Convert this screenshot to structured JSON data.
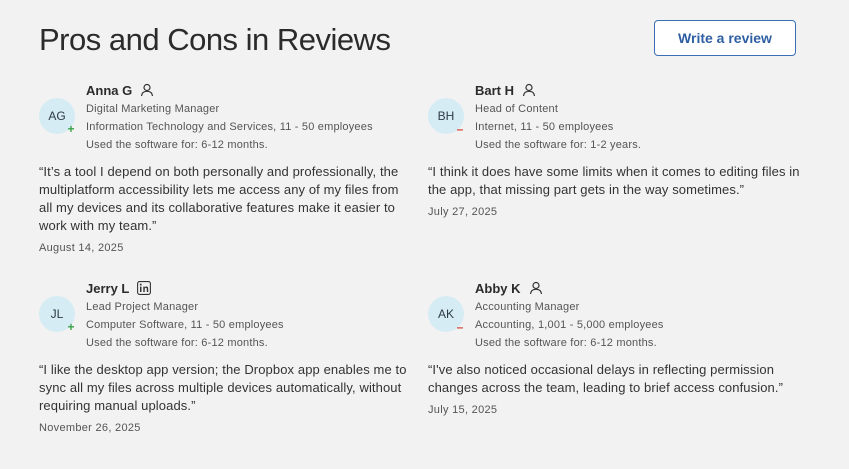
{
  "header": {
    "title": "Pros and Cons in Reviews",
    "write_review_label": "Write a review"
  },
  "reviews": [
    {
      "initials": "AG",
      "name": "Anna G",
      "badge": "user-icon",
      "sentiment": "+",
      "role": "Digital Marketing Manager",
      "company": "Information Technology and Services, 11 - 50 employees",
      "usage": "Used the software for: 6-12 months.",
      "quote": "“It’s a tool I depend on both personally and professionally, the multiplatform accessibility lets me access any of my files from all my devices and its collaborative features make it easier to work with my team.”",
      "date": "August 14, 2025"
    },
    {
      "initials": "BH",
      "name": "Bart H",
      "badge": "user-icon",
      "sentiment": "–",
      "role": "Head of Content",
      "company": "Internet, 11 - 50 employees",
      "usage": "Used the software for: 1-2 years.",
      "quote": "“I think it does have some limits when it comes to editing files in the app, that missing part gets in the way sometimes.”",
      "date": "July 27, 2025"
    },
    {
      "initials": "JL",
      "name": "Jerry L",
      "badge": "linkedin-icon",
      "sentiment": "+",
      "role": "Lead Project Manager",
      "company": "Computer Software, 11 - 50 employees",
      "usage": "Used the software for: 6-12 months.",
      "quote": "“I like the desktop app version; the Dropbox app enables me to sync all my files across multiple devices automatically, without requiring manual uploads.”",
      "date": "November 26, 2025"
    },
    {
      "initials": "AK",
      "name": "Abby K",
      "badge": "user-icon",
      "sentiment": "–",
      "role": "Accounting Manager",
      "company": "Accounting, 1,001 - 5,000 employees",
      "usage": "Used the software for: 6-12 months.",
      "quote": "“I've also noticed occasional delays in reflecting permission changes across the team, leading to brief access confusion.”",
      "date": "July 15, 2025"
    }
  ]
}
